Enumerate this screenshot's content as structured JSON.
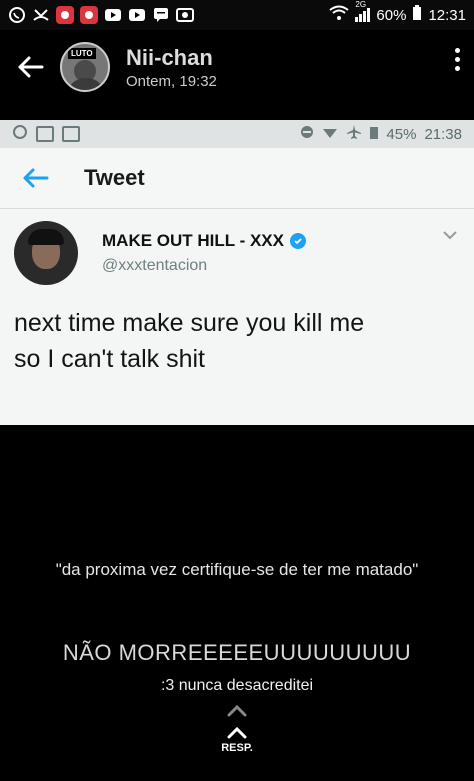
{
  "status_bar": {
    "battery": "60%",
    "time": "12:31",
    "signal_label": "2G"
  },
  "header": {
    "chat_name": "Nii-chan",
    "timestamp": "Ontem, 19:32",
    "avatar_badge": "LUTO"
  },
  "tweet_screenshot": {
    "status": {
      "battery": "45%",
      "time": "21:38"
    },
    "bar_title": "Tweet",
    "display_name": "MAKE OUT HILL - XXX",
    "handle": "@xxxtentacion",
    "text": "next time make sure you kill me\nso I can't talk shit"
  },
  "caption": {
    "quote": "\"da proxima vez certifique-se de ter me matado\"",
    "shout": "NÃO MORREEEEEUUUUUUUUU",
    "sub": ":3 nunca desacreditei"
  },
  "reply": {
    "label": "RESP."
  },
  "colors": {
    "verified": "#1da1f2",
    "notif_red": "#d9363e"
  }
}
